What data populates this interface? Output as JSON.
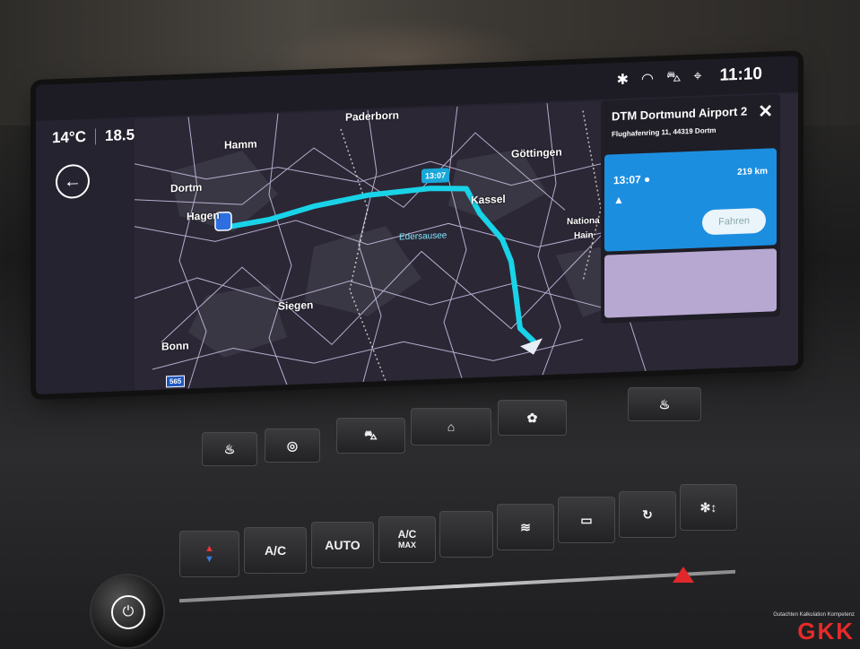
{
  "status": {
    "time": "11:10",
    "icons": [
      "bluetooth-icon",
      "wifi-icon",
      "car-connect-icon",
      "location-icon"
    ]
  },
  "climate": {
    "outside_temp": "14°C",
    "set_temp": "18.5",
    "fan_icon": "fan-icon",
    "airflow_icon": "airflow-icon"
  },
  "map": {
    "cities": [
      "Hamm",
      "Paderborn",
      "Dortm",
      "Hagen",
      "Göttingen",
      "Kassel",
      "Siegen",
      "Bonn",
      "Nationa",
      "Hain"
    ],
    "lake": "Edersausee",
    "eta_badge": "13:07",
    "highway": "565"
  },
  "route_panel": {
    "destination": "DTM Dortmund Airport 2",
    "address": "Flughafenring 11, 44319 Dortm",
    "route": {
      "eta": "13:07",
      "distance": "219 km",
      "go_label": "Fahren"
    }
  },
  "hardware": {
    "row1": [
      "seat-heat-icon",
      "steering-heat-icon",
      "car-icon",
      "home-icon",
      "fan-settings-icon",
      "seat-vent-icon"
    ],
    "row2": {
      "ac": "A/C",
      "auto": "AUTO",
      "ac_max_top": "A/C",
      "ac_max_bottom": "MAX"
    }
  },
  "logo": {
    "tag": "Gutachten Kalkulation Kompetenz",
    "text": "GKK"
  },
  "colors": {
    "route": "#19d3e8",
    "card": "#1c8ee0",
    "hazard": "#e0282b"
  }
}
